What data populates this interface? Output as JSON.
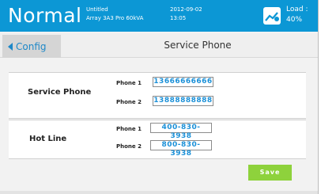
{
  "status_bar": {
    "mode": "Normal",
    "device_line1": "Untitled",
    "device_line2": "Array 3A3 Pro 60kVA",
    "date": "2012-09-02",
    "time": "13:05",
    "load_label": "Load :",
    "load_value": "40%",
    "icon": "load-gauge-icon",
    "color": "#0c97d5"
  },
  "nav": {
    "back_label": "Config",
    "title": "Service Phone"
  },
  "service_phone": {
    "label": "Service  Phone",
    "phone1_label": "Phone 1",
    "phone1_value": "13666666666",
    "phone2_label": "Phone 2",
    "phone2_value": "13888888888"
  },
  "hot_line": {
    "label": "Hot Line",
    "phone1_label": "Phone 1",
    "phone1_value": "400-830-3938",
    "phone2_label": "Phone 2",
    "phone2_value": "800-830-3938"
  },
  "actions": {
    "save_label": "Save",
    "save_color": "#8ed23c"
  }
}
